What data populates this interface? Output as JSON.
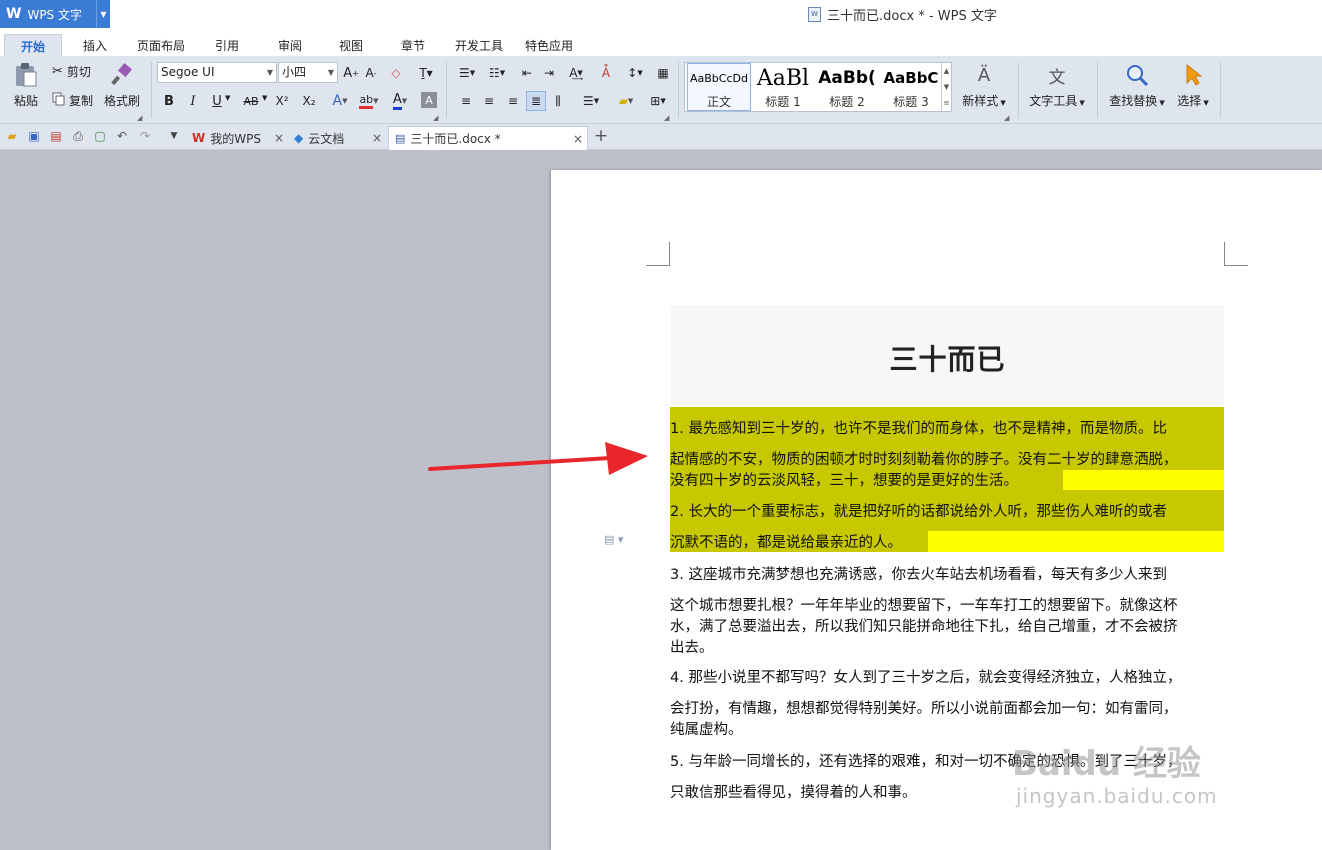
{
  "app": {
    "logo_text": "W",
    "name": "WPS 文字",
    "window_title": "三十而已.docx * - WPS 文字"
  },
  "ribbon_tabs": [
    "开始",
    "插入",
    "页面布局",
    "引用",
    "审阅",
    "视图",
    "章节",
    "开发工具",
    "特色应用"
  ],
  "toolbar": {
    "paste_label": "粘贴",
    "cut_label": "剪切",
    "copy_label": "复制",
    "format_painter_label": "格式刷",
    "font_name": "Segoe UI",
    "font_size": "小四",
    "bold": "B",
    "italic": "I",
    "underline": "U",
    "strikethrough": "AB",
    "superscript": "X²",
    "subscript": "X₂",
    "styles": [
      {
        "preview": "AaBbCcDd",
        "label": "正文"
      },
      {
        "preview": "AaBl",
        "label": "标题 1"
      },
      {
        "preview": "AaBb(",
        "label": "标题 2"
      },
      {
        "preview": "AaBbC",
        "label": "标题 3"
      }
    ],
    "new_style_label": "新样式",
    "text_tools_label": "文字工具",
    "find_replace_label": "查找替换",
    "select_label": "选择"
  },
  "doc_tabs": [
    {
      "label": "我的WPS",
      "icon": "wps-icon"
    },
    {
      "label": "云文档",
      "icon": "cloud-cube-icon"
    },
    {
      "label": "三十而已.docx *",
      "icon": "document-icon"
    }
  ],
  "document": {
    "title": "三十而已",
    "paragraphs": [
      {
        "lines": [
          "1. 最先感知到三十岁的，也许不是我们的而身体，也不是精神，而是物质。比",
          "起情感的不安，物质的困顿才时时刻刻勒着你的脖子。没有二十岁的肆意洒脱，",
          "没有四十岁的云淡风轻，三十，想要的是更好的生活。"
        ]
      },
      {
        "lines": [
          "2. 长大的一个重要标志，就是把好听的话都说给外人听，那些伤人难听的或者",
          "沉默不语的，都是说给最亲近的人。"
        ]
      },
      {
        "lines": [
          "3. 这座城市充满梦想也充满诱惑，你去火车站去机场看看，每天有多少人来到",
          "这个城市想要扎根？一年年毕业的想要留下，一车车打工的想要留下。就像这杯",
          "水，满了总要溢出去，所以我们知只能拼命地往下扎，给自己增重，才不会被挤",
          "出去。"
        ]
      },
      {
        "lines": [
          "4. 那些小说里不都写吗？女人到了三十岁之后，就会变得经济独立，人格独立，",
          "会打扮，有情趣，想想都觉得特别美好。所以小说前面都会加一句：如有雷同，",
          "纯属虚构。"
        ]
      },
      {
        "lines": [
          "5. 与年龄一同增长的，还有选择的艰难，和对一切不确定的恐惧。到了三十岁，",
          "只敢信那些看得见，摸得着的人和事。"
        ]
      }
    ]
  },
  "watermark": {
    "line1": "Baidu 经验",
    "line2": "jingyan.baidu.com"
  },
  "colors": {
    "accent": "#3a7bd5",
    "highlight_olive": "#c8c800",
    "highlight_yellow": "#ffff00",
    "arrow": "#e8262b"
  }
}
